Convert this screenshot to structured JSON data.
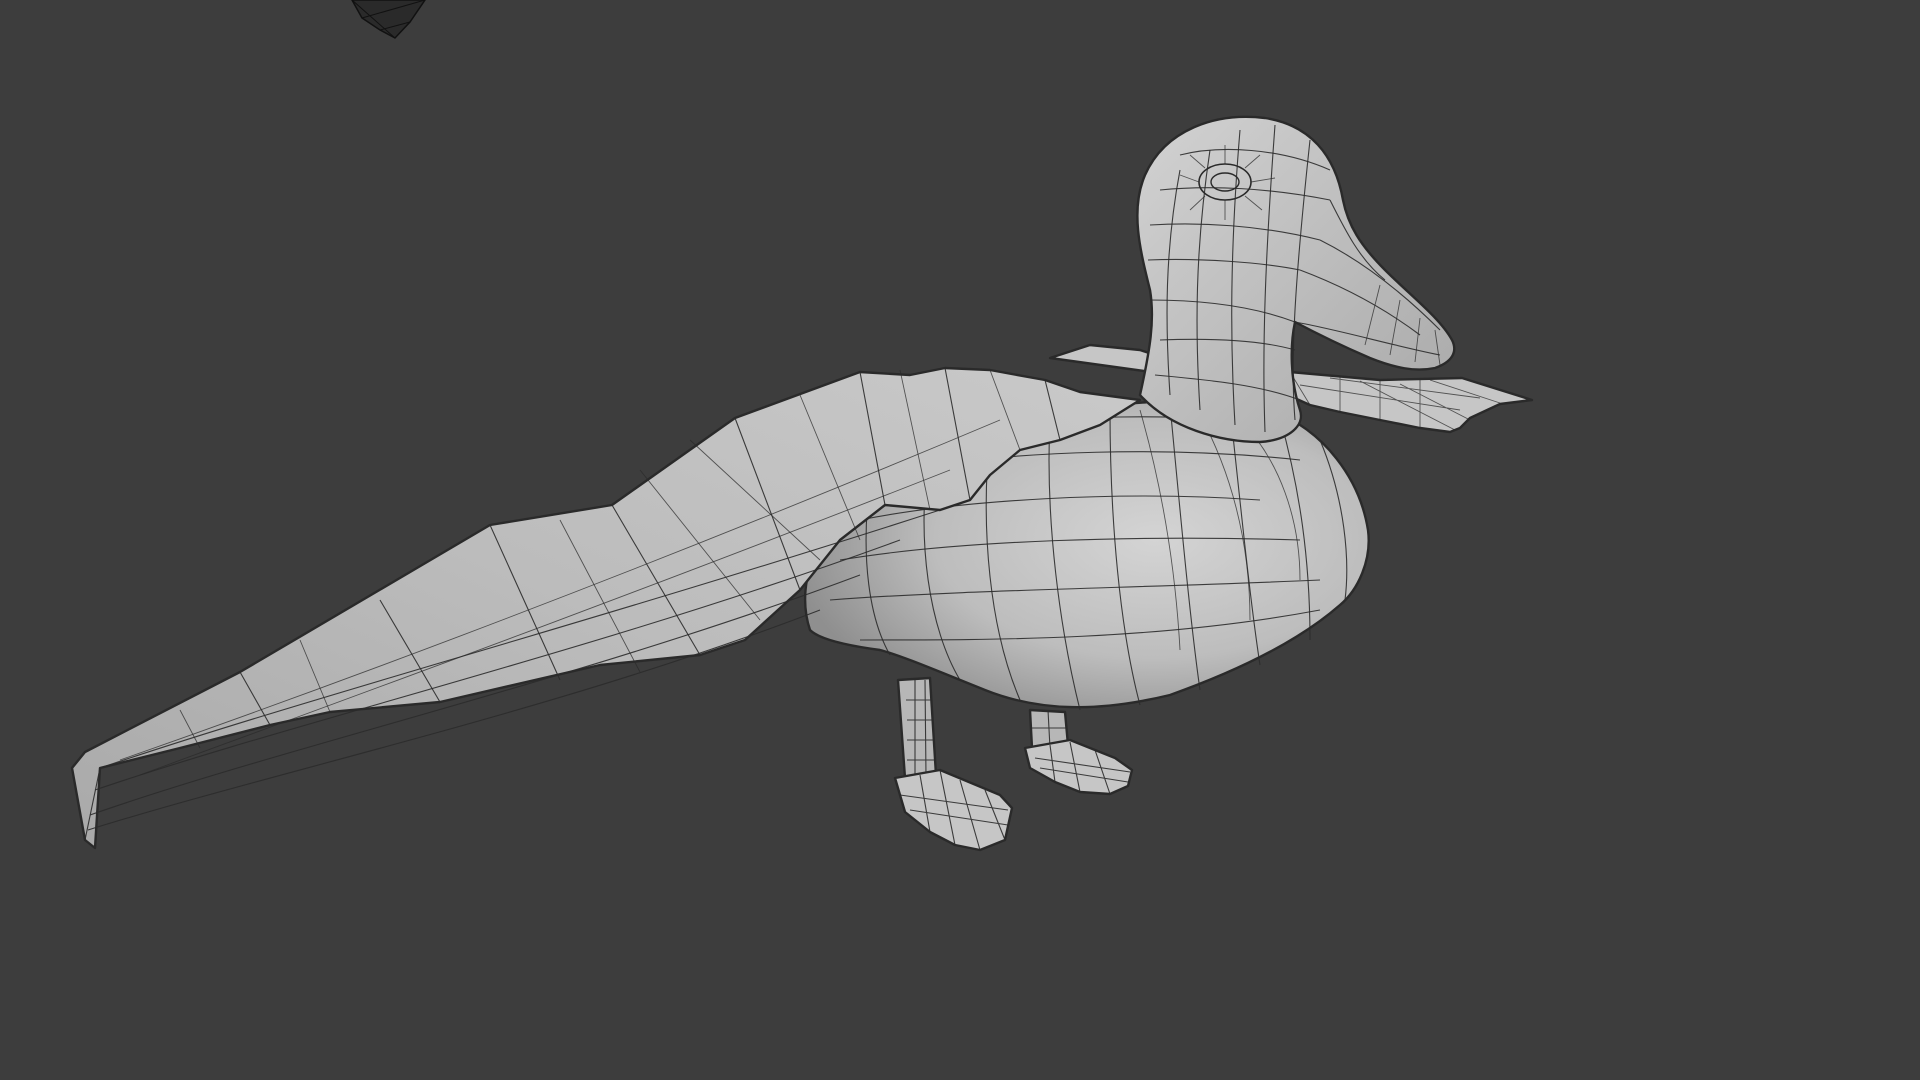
{
  "viewport": {
    "background": "#3d3d3d",
    "object": "duck-mesh",
    "display_mode": "solid-wireframe"
  },
  "camera_gizmo": {
    "icon": "camera-icon"
  }
}
